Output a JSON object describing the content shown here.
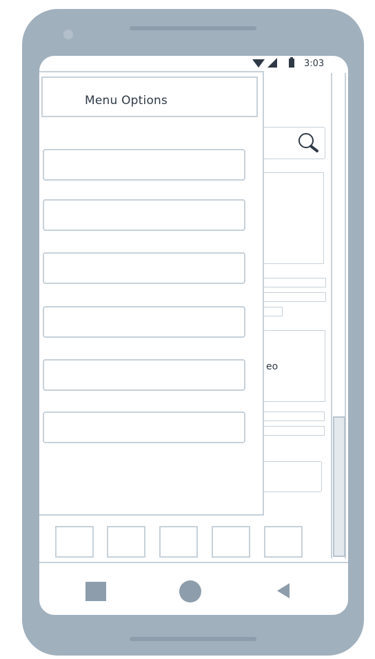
{
  "status_bar": {
    "time": "3:03"
  },
  "drawer": {
    "title": "Menu Options",
    "items": [
      "",
      "",
      "",
      "",
      "",
      ""
    ]
  },
  "content": {
    "partial_label": "eo"
  },
  "icons": {
    "search": "search-icon",
    "wifi": "wifi-icon",
    "signal": "signal-icon",
    "battery": "battery-icon",
    "nav_recent": "recent-apps-icon",
    "nav_home": "home-icon",
    "nav_back": "back-icon"
  },
  "colors": {
    "phone_body": "#a1b0bd",
    "outline": "#c7d1d9",
    "text": "#2f3a46",
    "nav_icon": "#8d9dab"
  }
}
